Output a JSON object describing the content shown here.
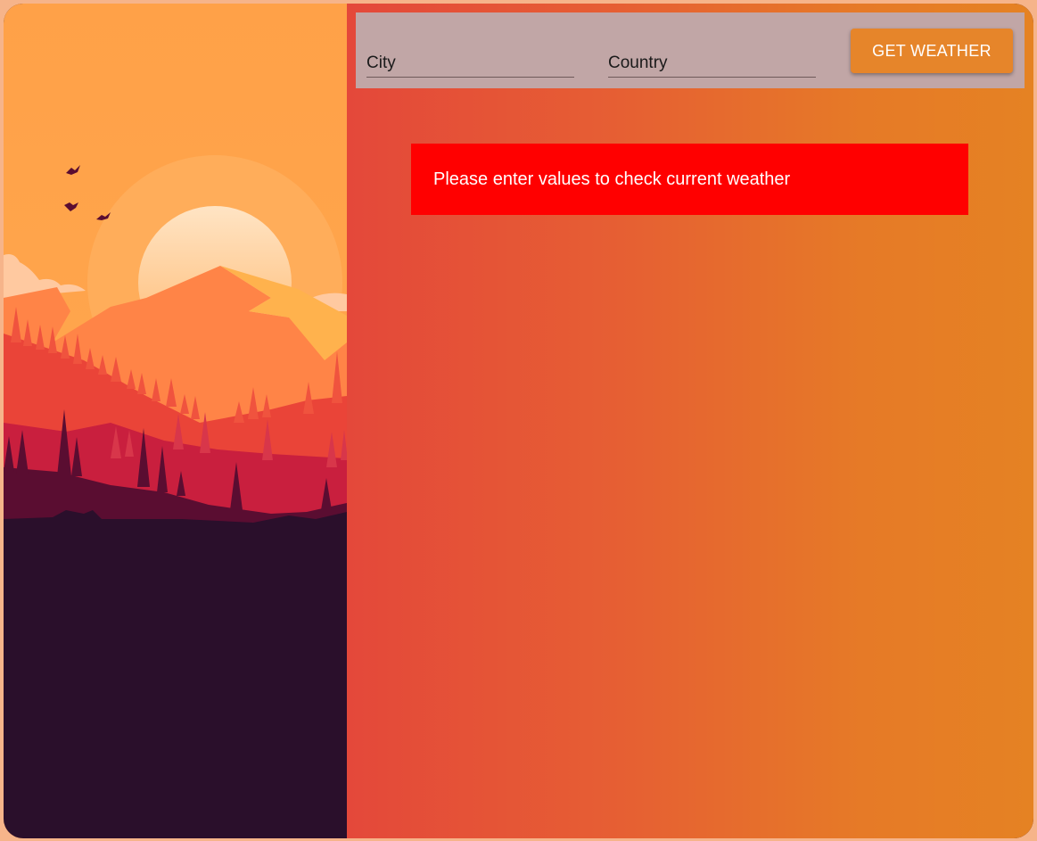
{
  "search": {
    "city_placeholder": "City",
    "city_value": "",
    "country_placeholder": "Country",
    "country_value": "",
    "button_label": "GET WEATHER"
  },
  "message": {
    "text": "Please enter values to check current weather"
  },
  "colors": {
    "search_bar_bg": "#c1a6a6",
    "button_bg": "#e6852a",
    "alert_bg": "#ff0000",
    "gradient_start": "#e4483a",
    "gradient_end": "#e58223"
  }
}
